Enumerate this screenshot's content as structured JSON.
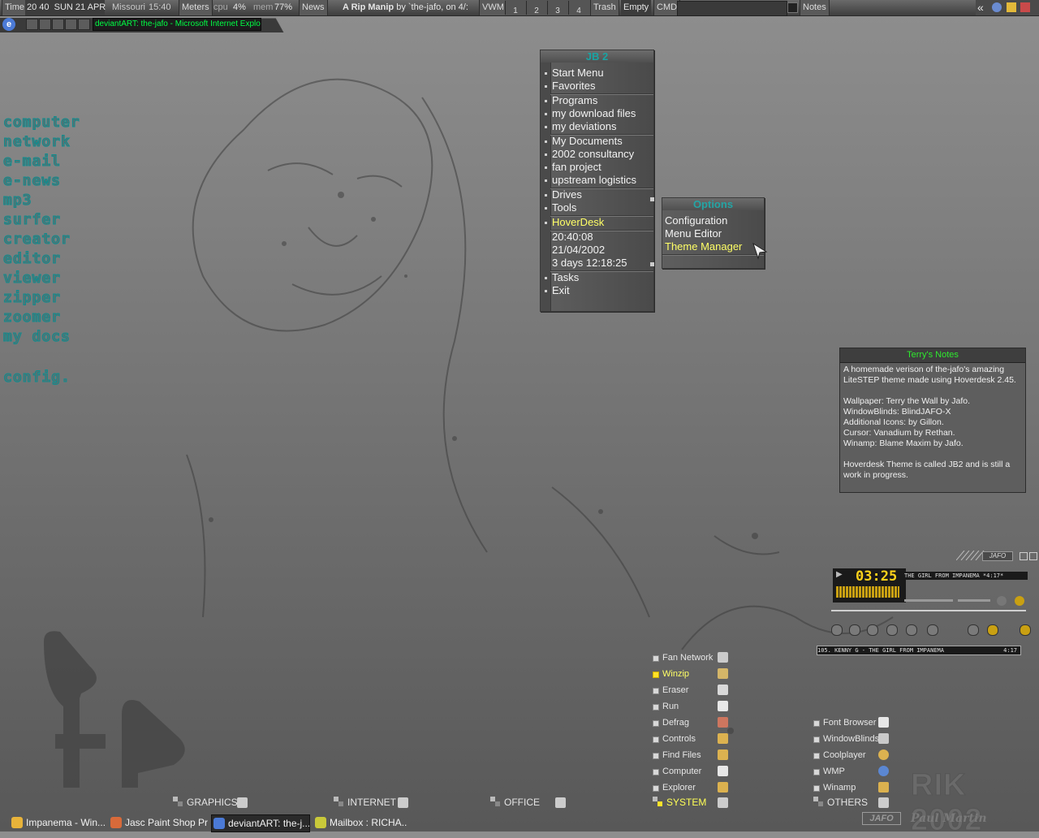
{
  "topbar": {
    "time_label": "Time",
    "time_value": "20 40",
    "date": "SUN 21 APR",
    "location": "Missouri",
    "location_time": "15:40",
    "meters_label": "Meters",
    "cpu_label": "cpu",
    "cpu_value": "4%",
    "mem_label": "mem",
    "mem_value": "77%",
    "news_label": "News",
    "news_title": "A Rip Manip",
    "news_rest": "by `the-jafo, on 4/:",
    "vwm_label": "VWM",
    "vwm_desks": [
      "1",
      "2",
      "3",
      "4"
    ],
    "trash_label": "Trash",
    "empty_label": "Empty",
    "cmd_label": "CMD",
    "notes_label": "Notes",
    "tray_arrow": "«"
  },
  "window_bar": {
    "title": "deviantART: the-jafo - Microsoft Internet Explorer"
  },
  "left_menu": [
    "computer",
    "network",
    "e-mail",
    "e-news",
    "mp3",
    "surfer",
    "creator",
    "editor",
    "viewer",
    "zipper",
    "zoomer",
    "my docs",
    "config."
  ],
  "jb2_menu": {
    "title": "JB 2",
    "groups": [
      [
        "Start Menu",
        "Favorites"
      ],
      [
        "Programs",
        "my download files",
        "my deviations"
      ],
      [
        "My Documents",
        "2002 consultancy",
        "fan project",
        "upstream logistics"
      ],
      [
        "Drives",
        "Tools"
      ]
    ],
    "hoverdesk": "HoverDesk",
    "info": [
      "20:40:08",
      "21/04/2002",
      "3 days 12:18:25"
    ],
    "tail": [
      "Tasks",
      "Exit"
    ]
  },
  "options_menu": {
    "title": "Options",
    "items": [
      "Configuration",
      "Menu Editor",
      "Theme Manager"
    ],
    "highlighted": "Theme Manager"
  },
  "notes": {
    "title": "Terry's Notes",
    "body": "A homemade verison of the-jafo's amazing LiteSTEP theme made using Hoverdesk 2.45.\n\nWallpaper: Terry the Wall by Jafo.\nWindowBlinds: BlindJAFO-X\nAdditional Icons: by Gillon.\nCursor: Vanadium by Rethan.\nWinamp: Blame Maxim by Jafo.\n\nHoverdesk Theme is called JB2 and is still a work in progress."
  },
  "winamp": {
    "brand": "JAFO",
    "time": "03:25",
    "title_scroll": "THE GIRL FROM IMPANEMA  *4:17*",
    "playlist_entry": "105. KENNY G - THE GIRL FROM IMPANEMA",
    "playlist_time": "4:17"
  },
  "system_shortcuts": [
    {
      "label": "Fan Network",
      "icon": "network-icon",
      "highlight": false
    },
    {
      "label": "Winzip",
      "icon": "winzip-icon",
      "highlight": true
    },
    {
      "label": "Eraser",
      "icon": "eraser-icon",
      "highlight": false
    },
    {
      "label": "Run",
      "icon": "run-icon",
      "highlight": false
    },
    {
      "label": "Defrag",
      "icon": "defrag-icon",
      "highlight": false
    },
    {
      "label": "Controls",
      "icon": "controls-icon",
      "highlight": false
    },
    {
      "label": "Find Files",
      "icon": "find-files-icon",
      "highlight": false
    },
    {
      "label": "Computer",
      "icon": "computer-icon",
      "highlight": false
    },
    {
      "label": "Explorer",
      "icon": "explorer-icon",
      "highlight": false
    }
  ],
  "other_shortcuts": [
    {
      "label": "Font Browser",
      "icon": "font-browser-icon"
    },
    {
      "label": "WindowBlinds",
      "icon": "windowblinds-icon"
    },
    {
      "label": "Coolplayer",
      "icon": "coolplayer-icon"
    },
    {
      "label": "WMP",
      "icon": "wmp-icon"
    },
    {
      "label": "Winamp",
      "icon": "winamp-icon"
    }
  ],
  "groups": [
    {
      "label": "GRAPHICS",
      "highlight": false
    },
    {
      "label": "INTERNET",
      "highlight": false
    },
    {
      "label": "OFFICE",
      "highlight": false
    },
    {
      "label": "SYSTEM",
      "highlight": true
    },
    {
      "label": "OTHERS",
      "highlight": false
    }
  ],
  "taskbar": [
    {
      "label": "Impanema - Win...",
      "icon": "winamp-icon",
      "active": false
    },
    {
      "label": "Jasc Paint Shop Pro",
      "icon": "paint-shop-pro-icon",
      "active": false
    },
    {
      "label": "deviantART: the-j...",
      "icon": "internet-explorer-icon",
      "active": true
    },
    {
      "label": "Mailbox : RICHA...",
      "icon": "mailbox-icon",
      "active": false
    }
  ],
  "signature": {
    "rik": "RIK 2002",
    "jafo": "JAFO",
    "author": "Paul Martin"
  },
  "colors": {
    "accent_teal": "#0f8c8e",
    "highlight_yellow": "#ffff66",
    "notes_title_green": "#2eea2e",
    "ie_title_green": "#00ff44",
    "winamp_led": "#ffd21a"
  }
}
